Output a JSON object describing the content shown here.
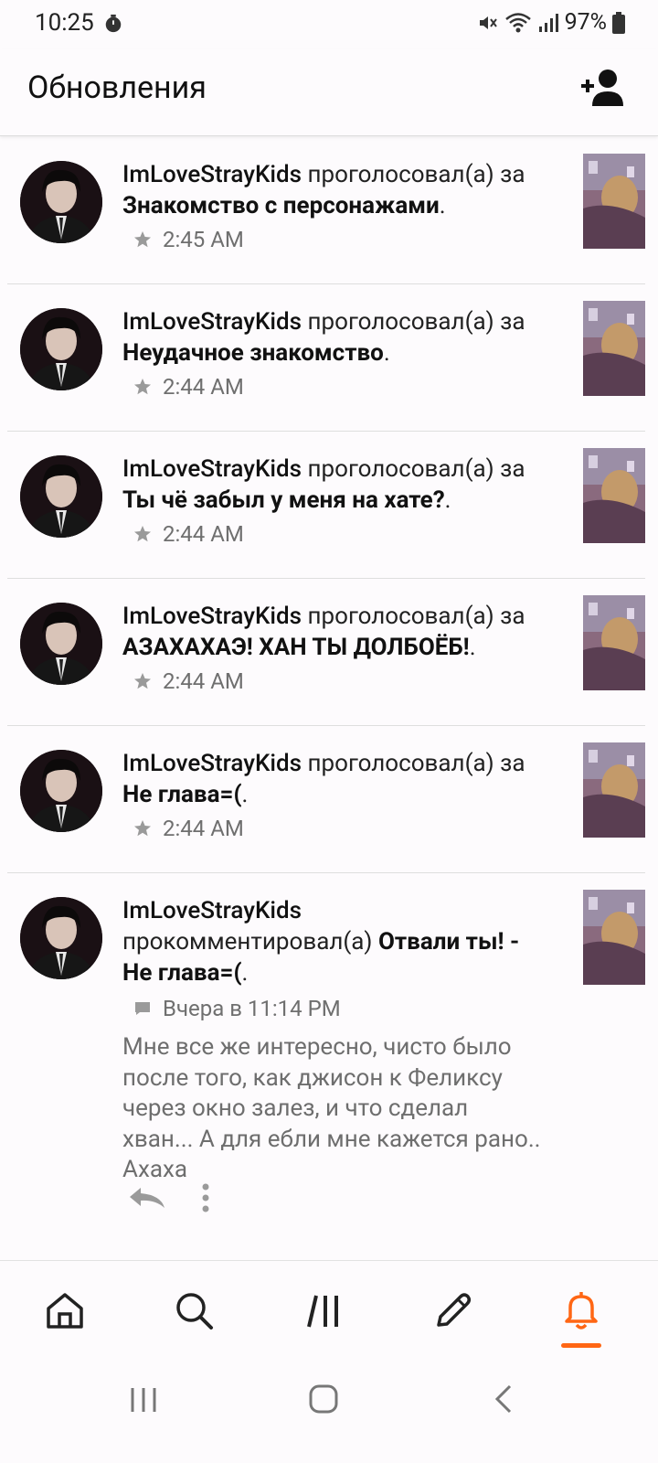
{
  "status_bar": {
    "time": "10:25",
    "battery": "97%"
  },
  "header": {
    "title": "Обновления"
  },
  "feed": [
    {
      "user": "ImLoveStrayKids",
      "action": "проголосовал(а)",
      "prep": "за",
      "story": "Знакомство с персонажами",
      "punct": ".",
      "time": "2:45 AM"
    },
    {
      "user": "ImLoveStrayKids",
      "action": "проголосовал(а)",
      "prep": "за",
      "story": "Неудачное знакомство",
      "punct": ".",
      "time": "2:44 AM"
    },
    {
      "user": "ImLoveStrayKids",
      "action": "проголосовал(а)",
      "prep": "за",
      "story": "Ты чё забыл у меня на хате?",
      "punct": ".",
      "time": "2:44 AM"
    },
    {
      "user": "ImLoveStrayKids",
      "action": "проголосовал(а)",
      "prep": "за",
      "story": "АЗАХАХАЭ! ХАН ТЫ ДОЛБОЁБ!",
      "punct": ".",
      "time": "2:44 AM"
    },
    {
      "user": "ImLoveStrayKids",
      "action": "проголосовал(а)",
      "prep": "за",
      "story": "Не глава=(",
      "punct": ".",
      "time": "2:44 AM"
    }
  ],
  "comment_item": {
    "user": "ImLoveStrayKids",
    "action": "прокомментировал(а)",
    "story": "Отвали ты! - Не глава=(",
    "punct": ".",
    "time": "Вчера в 11:14 PM",
    "comment": "Мне все же  интересно, чисто было после того, как джисон к Феликсу через окно залез, и что сделал хван... А для ебли мне кажется рано.. Ахаха"
  },
  "colors": {
    "accent": "#ff6614",
    "text": "#111111",
    "muted": "#6f6f6f"
  },
  "bottom_nav": [
    "home-icon",
    "search-icon",
    "library-icon",
    "pencil-icon",
    "bell-icon"
  ],
  "active_tab": "bell-icon"
}
